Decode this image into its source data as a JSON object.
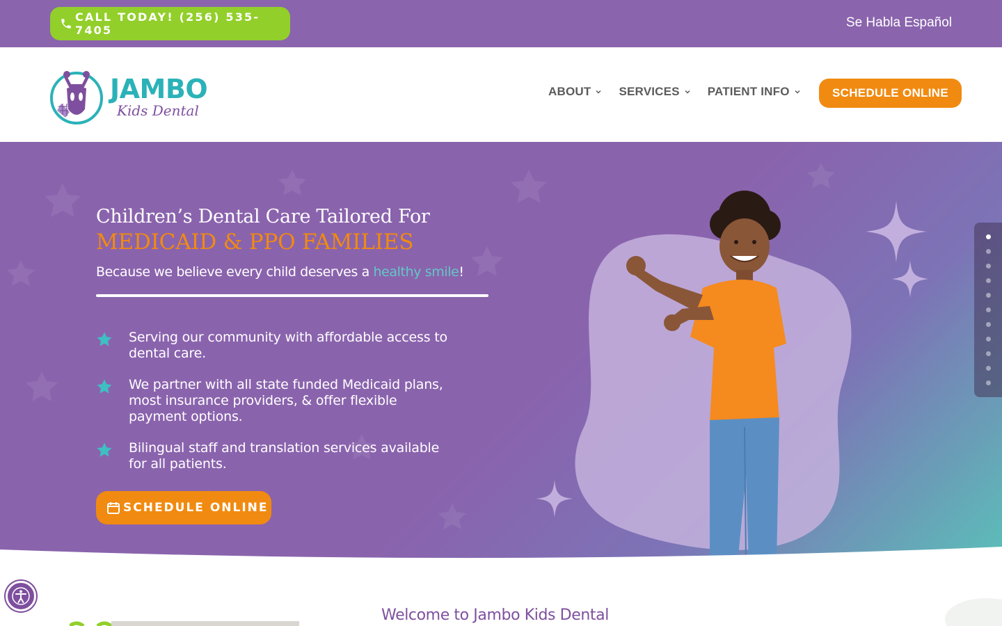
{
  "topbar": {
    "call_label": "CALL TODAY! (256) 535-7405",
    "language_link": "Se Habla Español"
  },
  "header": {
    "logo": {
      "brand": "JAMBO",
      "tagline": "Kids Dental"
    },
    "nav": [
      {
        "label": "ABOUT"
      },
      {
        "label": "SERVICES"
      },
      {
        "label": "PATIENT INFO"
      }
    ],
    "cta_label": "SCHEDULE ONLINE"
  },
  "hero": {
    "title_line1": "Children’s Dental Care Tailored For",
    "title_line2": "MEDICAID & PPO FAMILIES",
    "subtitle_before": "Because we believe every child deserves a ",
    "subtitle_highlight": "healthy smile",
    "subtitle_after": "!",
    "bullets": [
      {
        "text": "Serving our community with affordable access to dental care."
      },
      {
        "text": "We partner with all state funded Medicaid plans, most insurance providers, & offer flexible payment options."
      },
      {
        "text": "Bilingual staff and translation services available for all patients."
      }
    ],
    "cta_label": "SCHEDULE ONLINE"
  },
  "slider": {
    "slide_count": 11,
    "active_index": 0
  },
  "welcome": {
    "heading": "Welcome to Jambo Kids Dental"
  },
  "icons": {
    "call": "phone-icon",
    "nav_chevron": "chevron-down-icon",
    "bullet": "star-icon",
    "cta": "calendar-icon",
    "accessibility": "accessibility-icon"
  },
  "colors": {
    "purple": "#8a64ad",
    "green": "#92cf2a",
    "orange": "#f18a10",
    "teal": "#2bb2b8",
    "dark_purple": "#7e4f9e"
  }
}
